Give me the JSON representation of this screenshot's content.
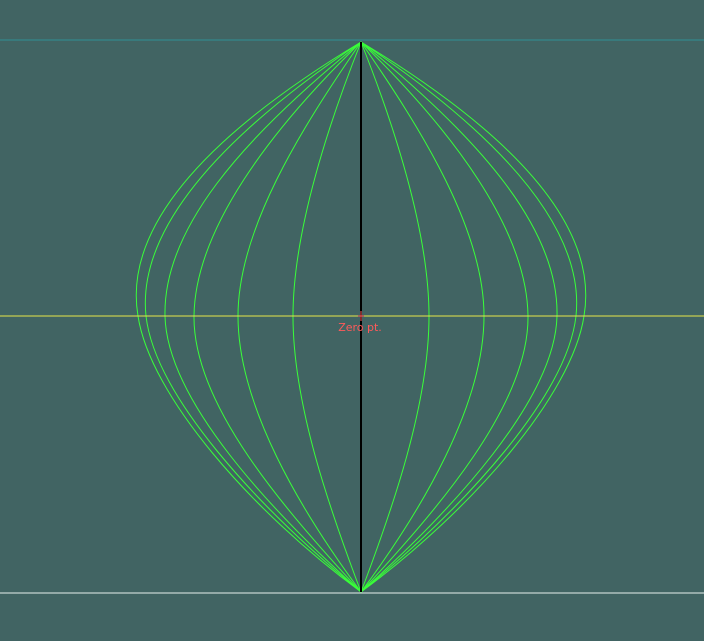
{
  "viewport": {
    "background": "#416463",
    "zero_point_label": "Zero pt.",
    "colors": {
      "top_guide": "#2f8f96",
      "horizontal_axis": "#e6e64a",
      "baseline": "#e8f0ee",
      "center_axis": "#000000",
      "curves": "#39ff39",
      "marker": "#ff5a5a"
    },
    "curve_count": 12
  }
}
